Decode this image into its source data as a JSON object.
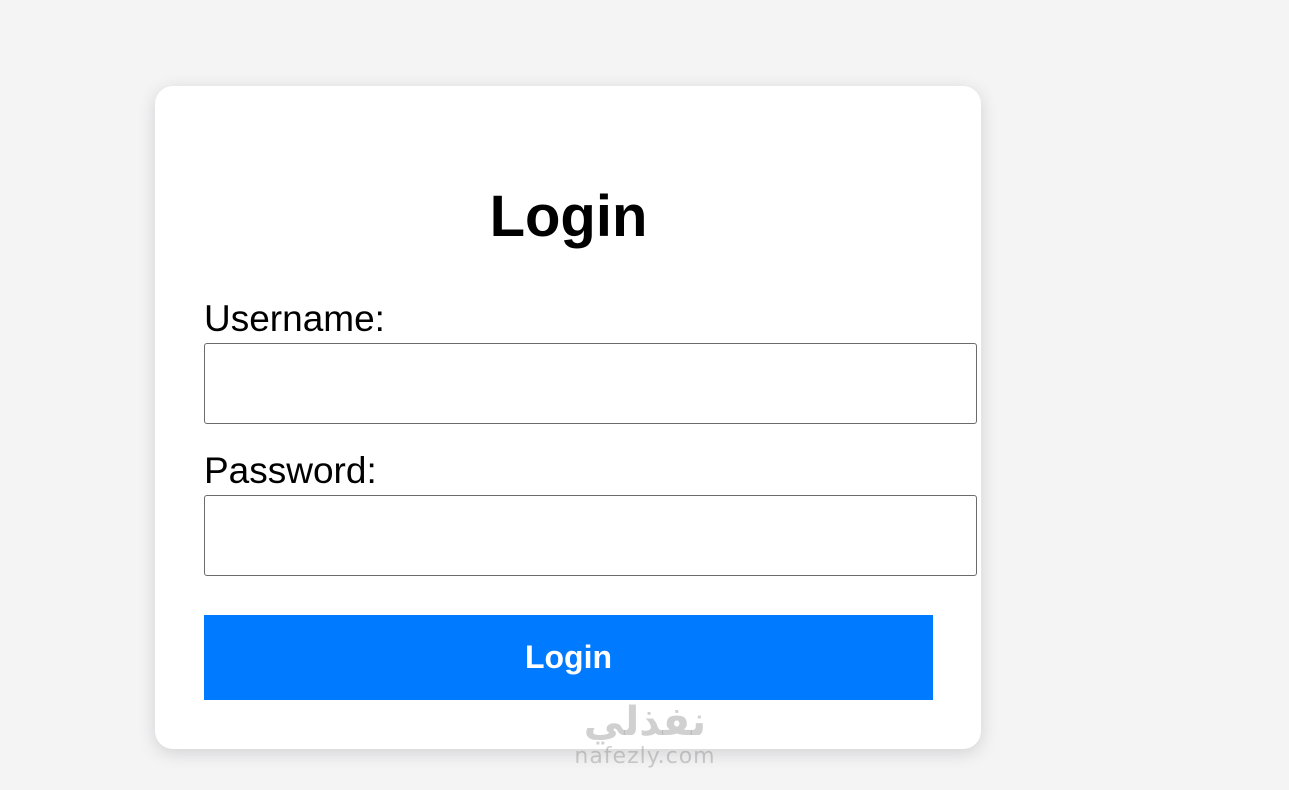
{
  "form": {
    "title": "Login",
    "username_label": "Username:",
    "username_value": "",
    "password_label": "Password:",
    "password_value": "",
    "submit_label": "Login"
  },
  "watermark": {
    "arabic": "نفذلي",
    "latin": "nafezly.com"
  },
  "colors": {
    "background": "#f4f4f5",
    "card": "#ffffff",
    "button": "#007bff",
    "button_text": "#ffffff"
  }
}
